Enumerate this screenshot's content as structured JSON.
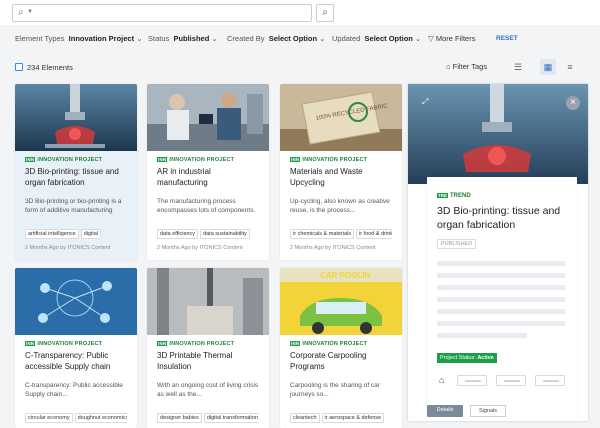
{
  "top": {
    "search_placeholder": ""
  },
  "filters": [
    {
      "label": "Element Types",
      "value": "Innovation Project"
    },
    {
      "label": "Status",
      "value": "Published"
    },
    {
      "label": "Created By",
      "value": "Select Option"
    },
    {
      "label": "Updated",
      "value": "Select Option"
    }
  ],
  "more_filters": "More Filters",
  "reset": "RESET",
  "toolbar": {
    "count": "234 Elements",
    "filter_tags": "Filter Tags"
  },
  "cards": [
    {
      "type": "INNOVATION PROJECT",
      "badge": "INN",
      "title": "3D Bio-printing: tissue and organ fabrication",
      "desc": "3D Bio-printing or bio-printing is a form of additive manufacturing",
      "tags": [
        "artificial intelligence",
        "digital"
      ],
      "meta": "2 Months Ago by ITONICS Content"
    },
    {
      "type": "INNOVATION PROJECT",
      "badge": "INN",
      "title": "AR in industrial manufacturing",
      "desc": "The manufacturing process encompasses lots of components.",
      "tags": [
        "data efficiency",
        "data sustainability"
      ],
      "meta": "2 Months Ago by ITONICS Content"
    },
    {
      "type": "INNOVATION PROJECT",
      "badge": "INN",
      "title": "Materials and Waste Upcycling",
      "desc": "Up-cycling, also known as creative reuse, is the process...",
      "tags": [
        "ir chemicals & materials",
        "ir food & drink"
      ],
      "meta": "2 Months Ago by ITONICS Content"
    },
    {
      "type": "INNOVATION PROJECT",
      "badge": "INN",
      "title": "C-Transparency: Public accessible Supply chain",
      "desc": "C-transparency: Public accessible Supply chain...",
      "tags": [
        "circular economy",
        "doughnut economics"
      ],
      "meta": ""
    },
    {
      "type": "INNOVATION PROJECT",
      "badge": "INN",
      "title": "3D Printable Thermal Insulation",
      "desc": "With an ongoing cost of living crisis as well as the...",
      "tags": [
        "designer babies",
        "digital transformation"
      ],
      "meta": ""
    },
    {
      "type": "INNOVATION PROJECT",
      "badge": "INN",
      "title": "Corporate Carpooling Programs",
      "desc": "Carpooling is the sharing of car journeys so...",
      "tags": [
        "cleantech",
        "ir aerospace & defense"
      ],
      "meta": ""
    }
  ],
  "upcycle_label": "100% RECYCLED FABRIC",
  "carpool_label": "CAR POOLIN",
  "panel": {
    "badge": "TRE",
    "type": "TREND",
    "title": "3D Bio-printing: tissue and organ fabrication",
    "status_chip": "PUBLISHED",
    "project_status_label": "Project Status:",
    "project_status_value": "Active",
    "details": "Details",
    "signals": "Signals"
  },
  "colors": {
    "accent": "#2d6fc9",
    "badge_green": "#1b9f48"
  }
}
